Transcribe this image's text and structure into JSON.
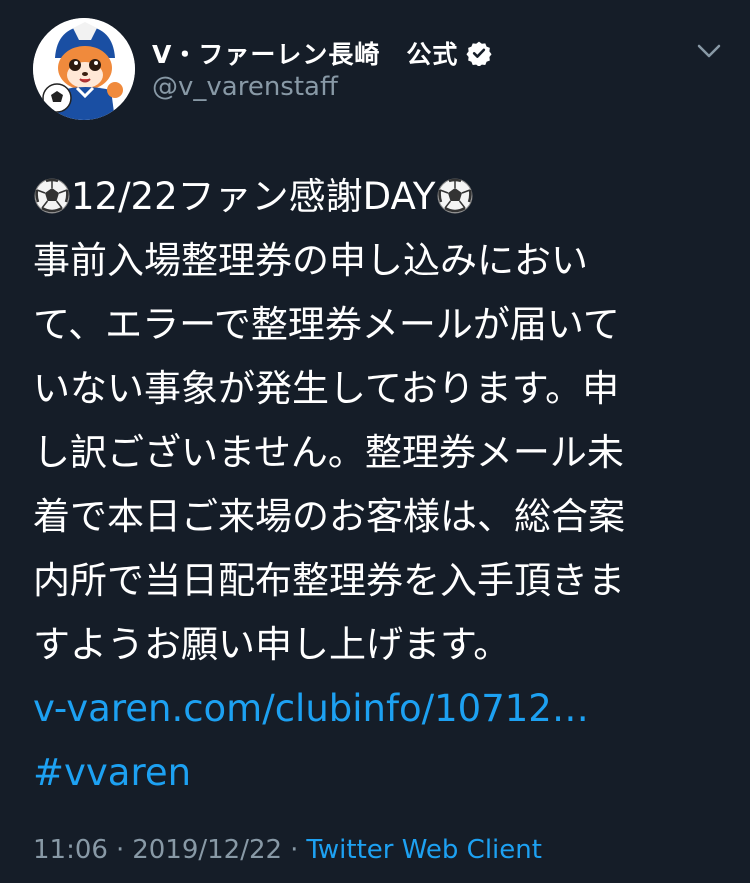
{
  "account": {
    "display_name": "V・ファーレン長崎　公式",
    "handle": "@v_varenstaff",
    "verified": true
  },
  "icons": {
    "verified": "verified-badge-icon",
    "caret": "chevron-down-icon",
    "ball": "soccer-ball-emoji"
  },
  "tweet": {
    "title_text": "12/22ファン感謝DAY",
    "lines": [
      "事前入場整理券の申し込みにおい",
      "て、エラーで整理券メールが届いて",
      "いない事象が発生しております。申",
      "し訳ございません。整理券メール未",
      "着で本日ご来場のお客様は、総合案",
      "内所で当日配布整理券を入手頂きま",
      "すようお願い申し上げます。"
    ],
    "link": "v-varen.com/clubinfo/10712…",
    "hashtag": "#vvaren"
  },
  "meta": {
    "time": "11:06",
    "separator": "·",
    "date": "2019/12/22",
    "client": "Twitter Web Client"
  },
  "colors": {
    "background": "#151d28",
    "text": "#ffffff",
    "muted": "#8899a6",
    "link": "#1da1f2"
  }
}
